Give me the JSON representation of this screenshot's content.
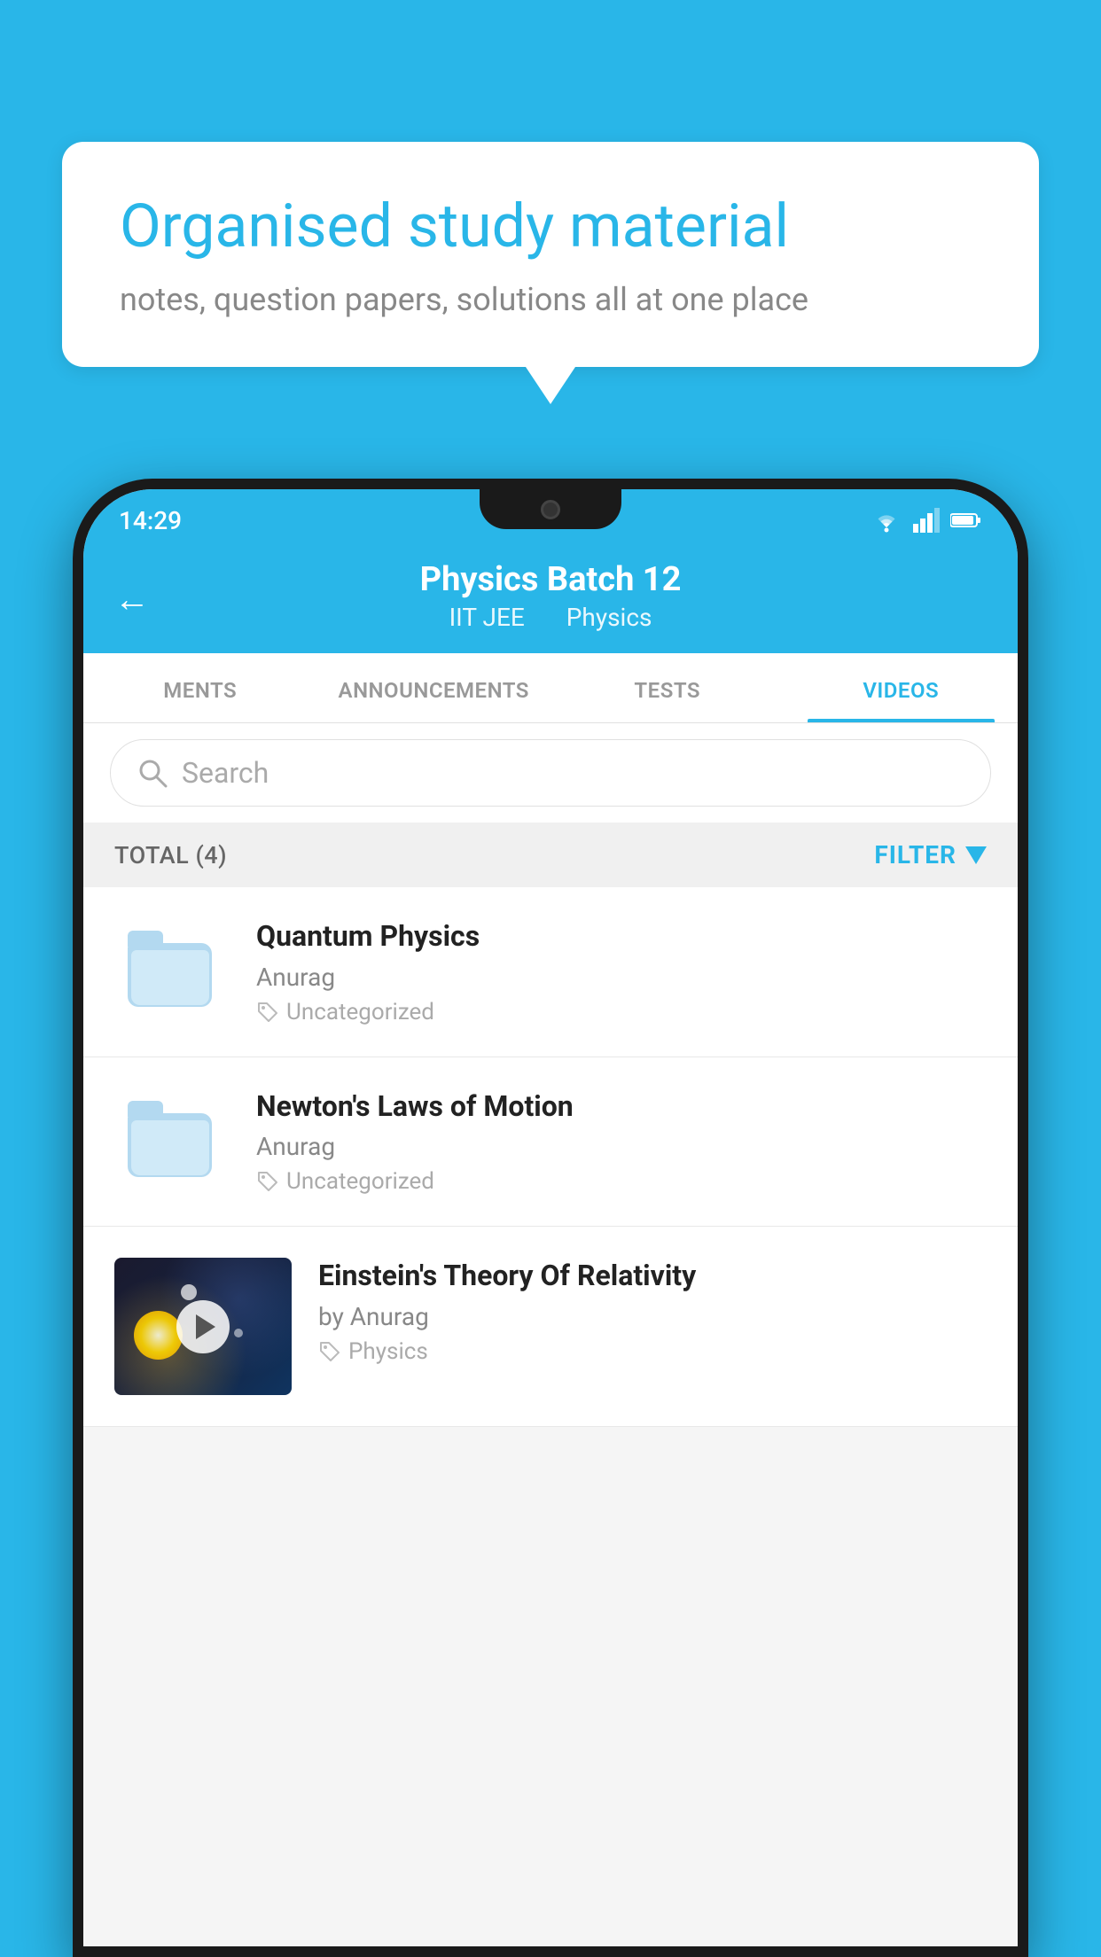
{
  "background_color": "#29b6e8",
  "speech_bubble": {
    "heading": "Organised study material",
    "subtext": "notes, question papers, solutions all at one place"
  },
  "status_bar": {
    "time": "14:29",
    "icons": [
      "wifi",
      "signal",
      "battery"
    ]
  },
  "header": {
    "title": "Physics Batch 12",
    "subtitle_part1": "IIT JEE",
    "subtitle_part2": "Physics",
    "back_label": "←"
  },
  "tabs": [
    {
      "id": "ments",
      "label": "MENTS",
      "active": false
    },
    {
      "id": "announcements",
      "label": "ANNOUNCEMENTS",
      "active": false
    },
    {
      "id": "tests",
      "label": "TESTS",
      "active": false
    },
    {
      "id": "videos",
      "label": "VIDEOS",
      "active": true
    }
  ],
  "search": {
    "placeholder": "Search"
  },
  "filter_bar": {
    "total_label": "TOTAL (4)",
    "filter_label": "FILTER"
  },
  "videos": [
    {
      "id": "1",
      "title": "Quantum Physics",
      "author": "Anurag",
      "tag": "Uncategorized",
      "thumb_type": "folder"
    },
    {
      "id": "2",
      "title": "Newton's Laws of Motion",
      "author": "Anurag",
      "tag": "Uncategorized",
      "thumb_type": "folder"
    },
    {
      "id": "3",
      "title": "Einstein's Theory Of Relativity",
      "author": "by Anurag",
      "tag": "Physics",
      "thumb_type": "image"
    }
  ]
}
